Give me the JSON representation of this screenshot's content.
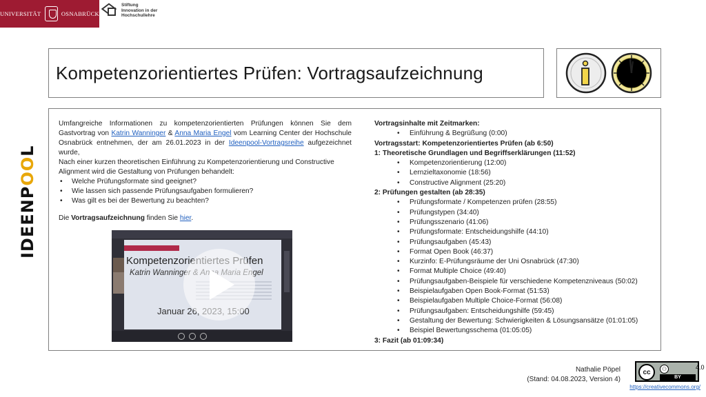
{
  "header": {
    "uni_left": "UNIVERSITÄT",
    "uni_right": "OSNABRÜCK",
    "stiftung_lines": [
      "Stiftung",
      "Innovation in der",
      "Hochschullehre"
    ]
  },
  "title": "Kompetenzorientiertes Prüfen: Vortragsaufzeichnung",
  "side_brand": {
    "part1": "IDEEN",
    "part2": "P",
    "part3": "OO",
    "part4": "L"
  },
  "left": {
    "intro_1": "Umfangreiche Informationen zu kompetenzorientierten Prüfungen können Sie dem Gastvortrag von",
    "link_1": "Katrin Wanninger",
    "amp": " & ",
    "link_2": "Anna Maria Engel",
    "intro_2": " vom Learning Center der Hochschule Osnabrück entnehmen, der am 26.01.2023 in der ",
    "link_3": "Ideenpool-Vortragsreihe",
    "intro_3": " aufgezeichnet wurde,",
    "intro_4": "Nach einer kurzen theoretischen Einführung zu Kompetenzorientierung und Constructive Alignment wird die Gestaltung von Prüfungen behandelt:",
    "questions": [
      "Welche Prüfungsformate sind geeignet?",
      "Wie lassen sich passende Prüfungsaufgaben formulieren?",
      "Was gilt es bei der Bewertung zu beachten?"
    ],
    "caption_pre": "Die ",
    "caption_bold": "Vortragsaufzeichnung",
    "caption_mid": " finden Sie ",
    "caption_link": "hier",
    "caption_end": "."
  },
  "video": {
    "title": "Kompetenzorientiertes Prüfen",
    "subtitle": "Katrin Wanninger & Anna Maria Engel",
    "date": "Januar 26, 2023, 15:00"
  },
  "right": {
    "heading": "Vortragsinhalte mit Zeitmarken:",
    "intro_items": [
      "Einführung & Begrüßung (0:00)"
    ],
    "start": "Vortragsstart: Kompetenzorientiertes Prüfen (ab 6:50)",
    "section1": "1: Theoretische Grundlagen und Begriffserklärungen (11:52)",
    "section1_items": [
      "Kompetenzorientierung (12:00)",
      "Lernzieltaxonomie (18:56)",
      "Constructive Alignment (25:20)"
    ],
    "section2": "2: Prüfungen gestalten (ab 28:35)",
    "section2_items": [
      "Prüfungsformate / Kompetenzen prüfen (28:55)",
      "Prüfungstypen (34:40)",
      "Prüfungsszenario (41:06)",
      "Prüfungsformate: Entscheidungshilfe (44:10)",
      "Prüfungsaufgaben (45:43)",
      "Format Open Book (46:37)",
      "Kurzinfo: E-Prüfungsräume der Uni Osnabrück (47:30)",
      "Format Multiple Choice (49:40)",
      "Prüfungsaufgaben-Beispiele für verschiedene Kompetenzniveaus (50:02)",
      "Beispielaufgaben Open Book-Format (51:53)",
      "Beispielaufgaben Multiple Choice-Format (56:08)",
      "Prüfungsaufgaben: Entscheidungshilfe (59:45)",
      "Gestaltung der Bewertung: Schwierigkeiten & Lösungsansätze (01:01:05)",
      "Beispiel Bewertungsschema (01:05:05)"
    ],
    "section3": "3: Fazit (ab 01:09:34)"
  },
  "footer": {
    "author": "Nathalie Pöpel",
    "stand": "(Stand: 04.08.2023,  Version 4)",
    "cc_label": "cc",
    "by_label": "BY",
    "cc_version": "4.0",
    "cc_url": "https://creativecommons.org/"
  },
  "colors": {
    "uni_red": "#9e1b32",
    "link": "#1f5fbf",
    "ideenpool_accent": "#e8a70a"
  }
}
